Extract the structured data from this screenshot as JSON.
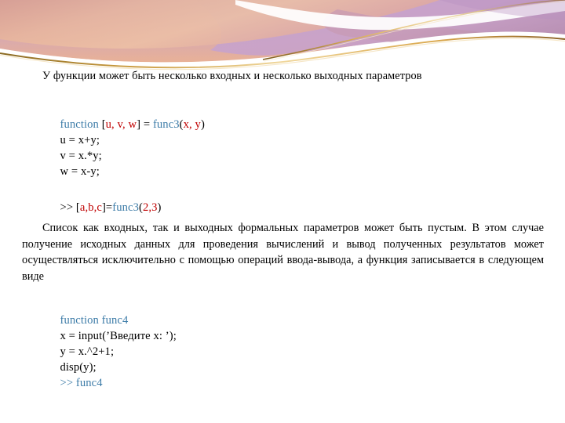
{
  "slide": {
    "background_color": "#ffffff",
    "header": {
      "name": "decorative-wave-banner",
      "colors": {
        "purple": "#b89ac9",
        "violet": "#c9a0cf",
        "mauve": "#c49ab5",
        "salmon": "#e0a894",
        "peach": "#edbfa4",
        "rose": "#d9a0a8",
        "gold": "#e0a33c",
        "gold_light": "#f2d79a",
        "white": "#ffffff"
      }
    },
    "colors": {
      "keyword_blue": "#3d7ca8",
      "variable_red": "#c00000",
      "text_black": "#000000"
    }
  },
  "content": {
    "intro_line": "У функции может быть несколько входных и несколько выходных параметров",
    "code_block_1": [
      {
        "name": "function-signature-line",
        "tokens": [
          {
            "text": "function ",
            "color": "keyword_blue"
          },
          {
            "text": "[",
            "color": "text_black"
          },
          {
            "text": "u, v, w",
            "color": "variable_red"
          },
          {
            "text": "] = ",
            "color": "text_black"
          },
          {
            "text": "func3",
            "color": "keyword_blue"
          },
          {
            "text": "(",
            "color": "text_black"
          },
          {
            "text": "x, y",
            "color": "variable_red"
          },
          {
            "text": ")",
            "color": "text_black"
          }
        ]
      },
      {
        "name": "assign-u-line",
        "tokens": [
          {
            "text": "u = x+y;",
            "color": "text_black"
          }
        ]
      },
      {
        "name": "assign-v-line",
        "tokens": [
          {
            "text": "v = x.*y;",
            "color": "text_black"
          }
        ]
      },
      {
        "name": "assign-w-line",
        "tokens": [
          {
            "text": "w = x-y;",
            "color": "text_black"
          }
        ]
      }
    ],
    "code_block_2": [
      {
        "name": "prompt-call-line",
        "tokens": [
          {
            "text": ">> ",
            "color": "text_black"
          },
          {
            "text": "[",
            "color": "text_black"
          },
          {
            "text": "a,b,c",
            "color": "variable_red"
          },
          {
            "text": "]=",
            "color": "text_black"
          },
          {
            "text": "func3",
            "color": "keyword_blue"
          },
          {
            "text": "(",
            "color": "text_black"
          },
          {
            "text": "2,3",
            "color": "variable_red"
          },
          {
            "text": ")",
            "color": "text_black"
          }
        ]
      }
    ],
    "paragraph": "Список как входных, так и выходных формальных параметров может быть пустым. В этом случае получение исходных данных для проведения вычислений и вывод полученных результатов может осуществляться исключительно с помощью операций ввода-вывода, а функция записывается в следующем виде",
    "code_block_3": [
      {
        "name": "function-func4-line",
        "tokens": [
          {
            "text": "function func4",
            "color": "keyword_blue"
          }
        ]
      },
      {
        "name": "input-line",
        "tokens": [
          {
            "text": "x = input(’Введите x: ’);",
            "color": "text_black"
          }
        ]
      },
      {
        "name": "assign-y-line",
        "tokens": [
          {
            "text": "y = x.^2+1;",
            "color": "text_black"
          }
        ]
      },
      {
        "name": "disp-line",
        "tokens": [
          {
            "text": "disp(y);",
            "color": "text_black"
          }
        ]
      },
      {
        "name": "prompt-func4-line",
        "tokens": [
          {
            "text": ">> func4",
            "color": "keyword_blue"
          }
        ]
      }
    ]
  }
}
